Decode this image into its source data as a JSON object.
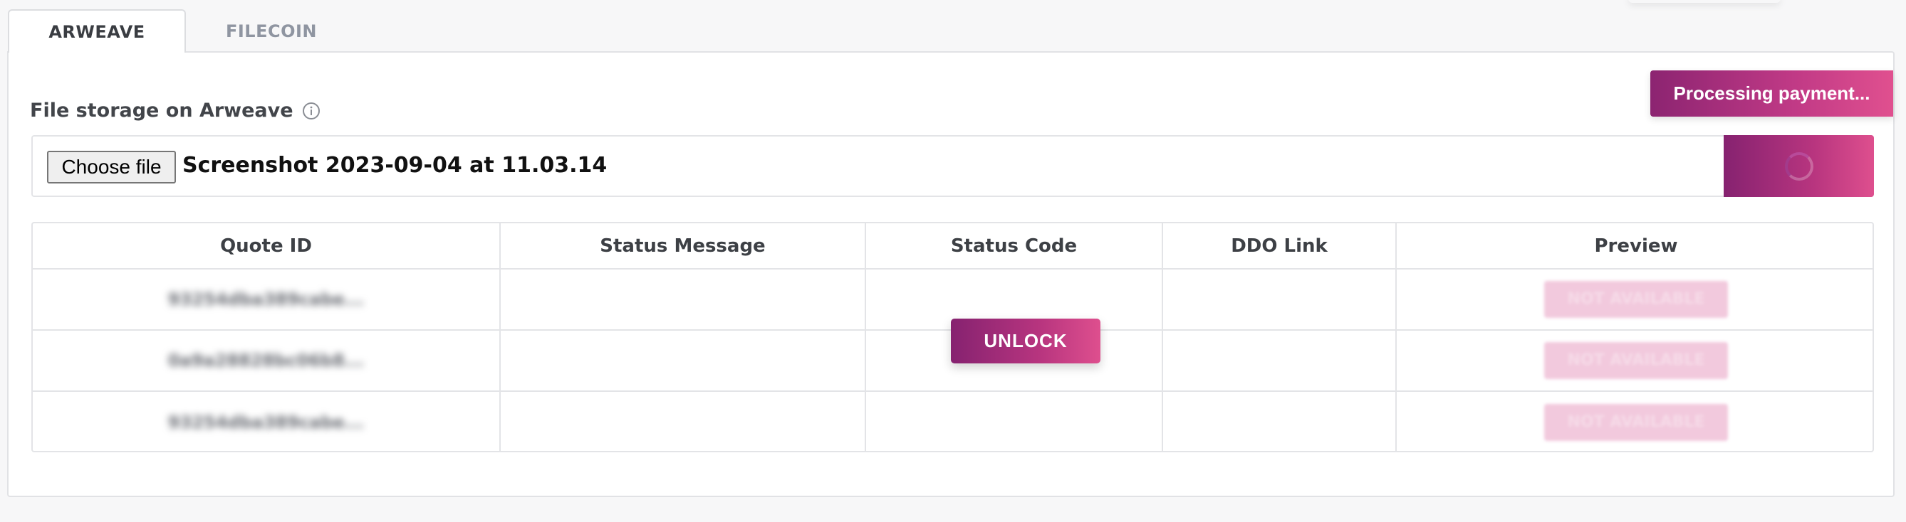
{
  "tabs": [
    {
      "label": "ARWEAVE",
      "active": true
    },
    {
      "label": "FILECOIN",
      "active": false
    }
  ],
  "process_button": {
    "label": "Processing payment..."
  },
  "section": {
    "label": "File storage on Arweave",
    "info_icon": "info-icon"
  },
  "file_input": {
    "choose_label": "Choose file",
    "file_name": "Screenshot 2023-09-04 at 11.03.14"
  },
  "upload_button": {
    "state_icon": "spinner-icon"
  },
  "table": {
    "headers": [
      "Quote ID",
      "Status Message",
      "Status Code",
      "DDO Link",
      "Preview"
    ],
    "rows": [
      {
        "quote_id": "93254dba389cabe...",
        "status_message": "",
        "status_code": "",
        "ddo_link": "",
        "preview": "NOT AVAILABLE"
      },
      {
        "quote_id": "0a9a28828bc06b8...",
        "status_message": "",
        "status_code": "",
        "ddo_link": "",
        "preview": "NOT AVAILABLE"
      },
      {
        "quote_id": "93254dba389cabe...",
        "status_message": "",
        "status_code": "",
        "ddo_link": "",
        "preview": "NOT AVAILABLE"
      }
    ]
  },
  "unlock_button": {
    "label": "UNLOCK"
  },
  "colors": {
    "accent_start": "#862270",
    "accent_end": "#de4f8e",
    "badge_disabled": "#f2c9dd"
  }
}
